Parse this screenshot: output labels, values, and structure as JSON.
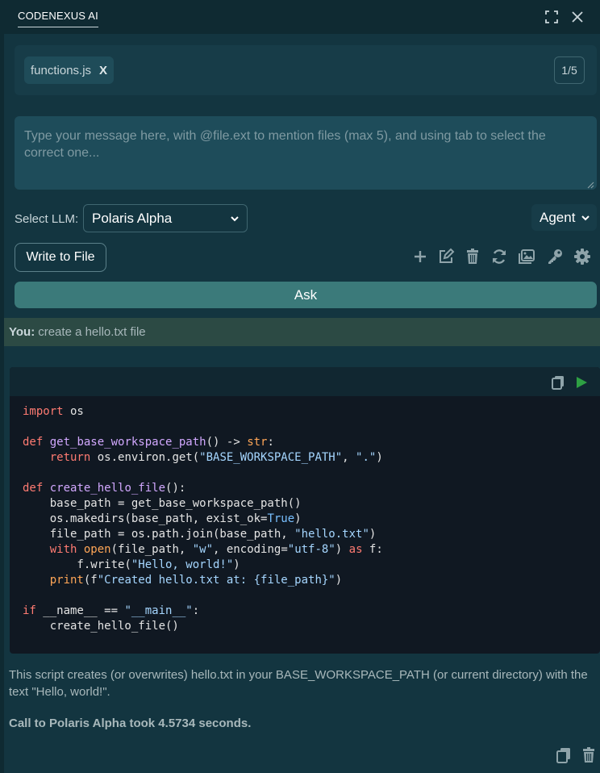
{
  "app": {
    "title": "CODENEXUS AI"
  },
  "files": {
    "chips": [
      {
        "name": "functions.js",
        "remove_label": "X"
      }
    ],
    "counter": "1/5"
  },
  "message": {
    "placeholder": "Type your message here, with @file.ext to mention files (max 5), and using tab to select the correct one..."
  },
  "llm": {
    "label": "Select LLM:",
    "selected": "Polaris Alpha"
  },
  "mode": {
    "selected": "Agent"
  },
  "actions": {
    "write_to_file": "Write to File",
    "ask": "Ask"
  },
  "conversation": {
    "user": {
      "speaker": "You:",
      "text": "create a hello.txt file"
    },
    "response": {
      "language": "python",
      "code_lines": [
        "import os",
        "",
        "def get_base_workspace_path() -> str:",
        "    return os.environ.get(\"BASE_WORKSPACE_PATH\", \".\")",
        "",
        "def create_hello_file():",
        "    base_path = get_base_workspace_path()",
        "    os.makedirs(base_path, exist_ok=True)",
        "    file_path = os.path.join(base_path, \"hello.txt\")",
        "    with open(file_path, \"w\", encoding=\"utf-8\") as f:",
        "        f.write(\"Hello, world!\")",
        "    print(f\"Created hello.txt at: {file_path}\")",
        "",
        "if __name__ == \"__main__\":",
        "    create_hello_file()"
      ],
      "description": "This script creates (or overwrites) hello.txt in your BASE_WORKSPACE_PATH (or current directory) with the text \"Hello, world!\".",
      "timing": "Call to Polaris Alpha took 4.5734 seconds."
    }
  },
  "icons": {
    "window": [
      "fullscreen-icon",
      "close-icon"
    ],
    "toolbar": [
      "plus-icon",
      "edit-icon",
      "trash-icon",
      "refresh-icon",
      "images-icon",
      "key-icon",
      "gear-icon"
    ],
    "code": [
      "copy-icon",
      "play-icon"
    ],
    "footer": [
      "copy-icon",
      "trash-icon"
    ]
  },
  "colors": {
    "background": "#0f2a32",
    "panel": "#133540",
    "accent": "#3b7a7a",
    "run": "#2ea043"
  }
}
